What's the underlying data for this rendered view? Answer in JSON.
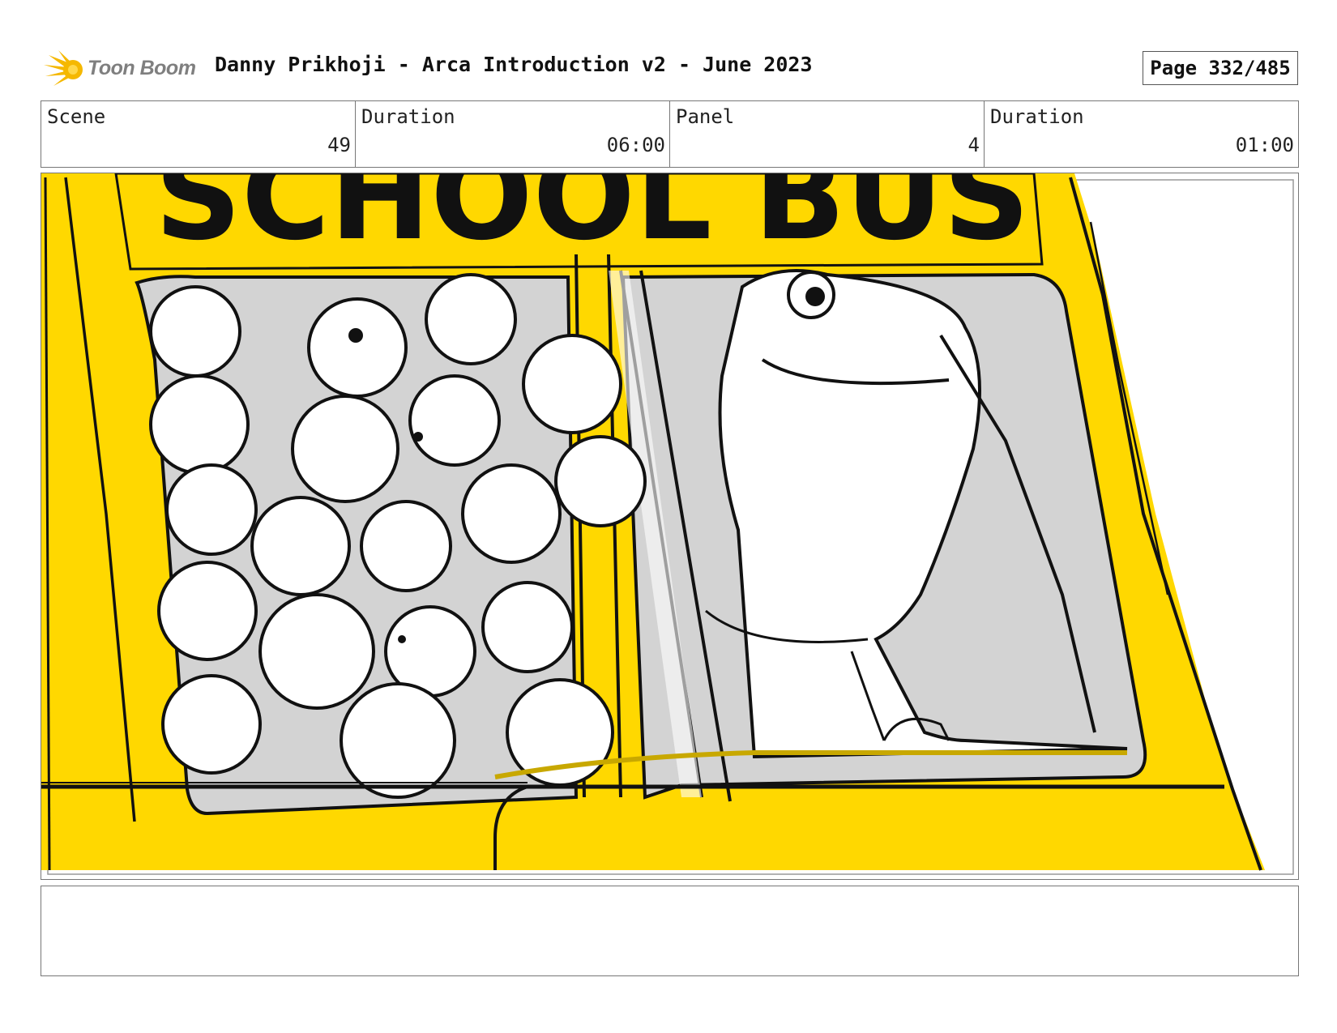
{
  "header": {
    "logo_text": "Toon Boom",
    "title": "Danny Prikhoji - Arca Introduction v2 - June 2023",
    "page_label": "Page 332/485"
  },
  "info": {
    "scene_label": "Scene",
    "scene_value": "49",
    "scene_duration_label": "Duration",
    "scene_duration_value": "06:00",
    "panel_label": "Panel",
    "panel_value": "4",
    "panel_duration_label": "Duration",
    "panel_duration_value": "01:00"
  },
  "panel_image": {
    "sign_text": "SCHOOL BUS",
    "colors": {
      "bus_yellow": "#FFD800",
      "window_gray": "#D3D3D3",
      "line": "#111111"
    }
  },
  "notes": {
    "text": ""
  }
}
